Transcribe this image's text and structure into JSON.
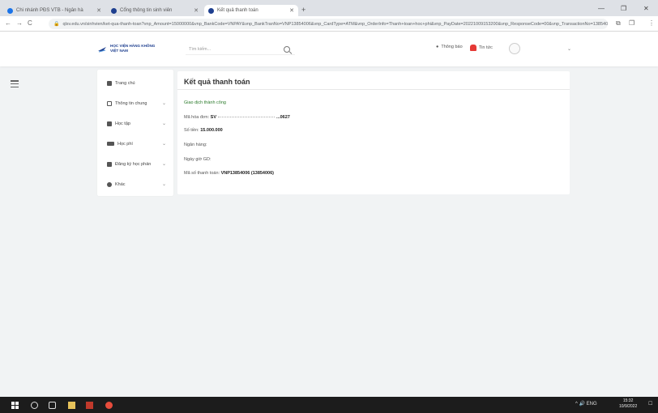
{
  "browser": {
    "tabs": [
      {
        "label": "Chi nhánh PĐS VTB - Ngân hà",
        "favicon_color": "#1a73e8",
        "active": false
      },
      {
        "label": "Cổng thông tin sinh viên",
        "favicon_color": "#1e3f8f",
        "active": false
      },
      {
        "label": "Kết quả thanh toán",
        "favicon_color": "#1e3f8f",
        "active": true
      }
    ],
    "new_tab_glyph": "+",
    "window_controls": [
      "⌄",
      "—",
      "❐",
      "✕"
    ],
    "nav_buttons": [
      "←",
      "→",
      "C"
    ],
    "url": "qlsv.edu.vn/sinhvien/ket-qua-thanh-toan?vnp_Amount=15000000&vnp_BankCode=VNPAY&vnp_BankTranNo=VNP13854006&vnp_CardType=ATM&vnp_OrderInfo=Thanh+toan+hoc+phi&vnp_PayDate=20221009153200&vnp_ResponseCode=00&vnp_TransactionNo=13854006",
    "toolbar_icons": [
      "☆",
      "⧉",
      "❐",
      "⋮"
    ]
  },
  "site": {
    "logo_line1": "HỌC VIỆN HÀNG KHÔNG",
    "logo_line2": "VIỆT NAM",
    "search_placeholder": "Tìm kiếm...",
    "header_links": [
      {
        "label": "Thông báo",
        "icon": "megaphone-icon"
      },
      {
        "label": "Tin tức",
        "icon": "bell-icon"
      }
    ],
    "brand_color": "#1e3f8f"
  },
  "sidebar": {
    "items": [
      {
        "label": "Trang chủ",
        "has_chevron": false
      },
      {
        "label": "Thông tin chung",
        "has_chevron": true
      },
      {
        "label": "Học tập",
        "has_chevron": true
      },
      {
        "label": "Học phí",
        "has_chevron": true
      },
      {
        "label": "Đăng ký học phần",
        "has_chevron": true
      },
      {
        "label": "Khác",
        "has_chevron": true
      }
    ]
  },
  "result": {
    "title": "Kết quả thanh toán",
    "status": "Giao dịch thành công",
    "rows": [
      {
        "label": "Mã hóa đơn:",
        "value": "SV",
        "suffix": "...0627"
      },
      {
        "label": "Số tiền:",
        "value": "15.000.000"
      },
      {
        "label": "Ngân hàng:",
        "value": ""
      },
      {
        "label": "Ngày giờ GD:",
        "value": ""
      },
      {
        "label": "Mã số thanh toán:",
        "value": "VNP13854006 (13854006)"
      }
    ]
  },
  "taskbar": {
    "tray_text": "^ 🔊 ENG",
    "time": "15:32",
    "date": "10/9/2022"
  }
}
